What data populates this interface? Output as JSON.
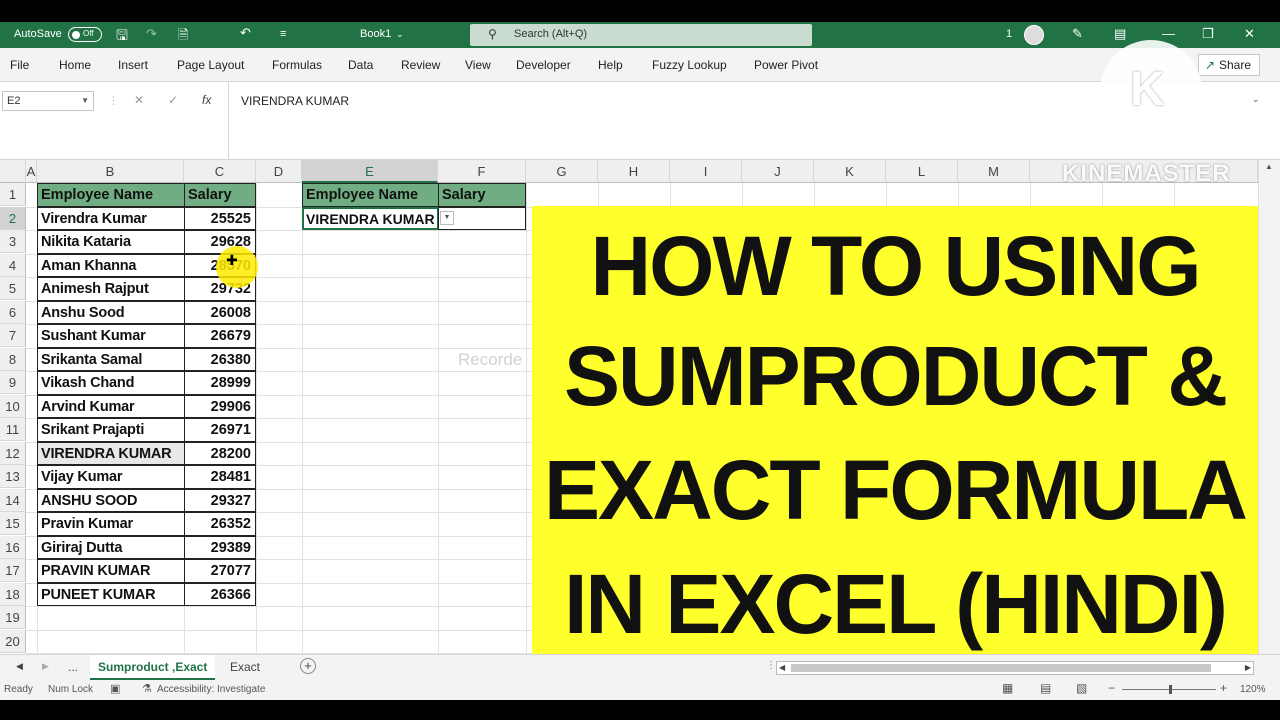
{
  "titlebar": {
    "autosave_label": "AutoSave",
    "autosave_state": "Off",
    "document_title": "Book1",
    "search_placeholder": "Search (Alt+Q)",
    "notification_count": "1"
  },
  "menu": {
    "items": [
      "File",
      "Home",
      "Insert",
      "Page Layout",
      "Formulas",
      "Data",
      "Review",
      "View",
      "Developer",
      "Help",
      "Fuzzy Lookup",
      "Power Pivot"
    ],
    "share_label": "Share"
  },
  "formula_bar": {
    "name_box": "E2",
    "fx_label": "fx",
    "value": "VIRENDRA KUMAR"
  },
  "columns": [
    "A",
    "B",
    "C",
    "D",
    "E",
    "F",
    "G",
    "H",
    "I",
    "J",
    "K",
    "L",
    "M"
  ],
  "rows": [
    "1",
    "2",
    "3",
    "4",
    "5",
    "6",
    "7",
    "8",
    "9",
    "10",
    "11",
    "12",
    "13",
    "14",
    "15",
    "16",
    "17",
    "18",
    "19",
    "20"
  ],
  "table": {
    "header_name": "Employee Name",
    "header_salary": "Salary",
    "records": [
      {
        "name": "Virendra Kumar",
        "salary": "25525"
      },
      {
        "name": "Nikita Kataria",
        "salary": "29628"
      },
      {
        "name": "Aman Khanna",
        "salary": "28570"
      },
      {
        "name": "Animesh Rajput",
        "salary": "29732"
      },
      {
        "name": "Anshu Sood",
        "salary": "26008"
      },
      {
        "name": "Sushant Kumar",
        "salary": "26679"
      },
      {
        "name": "Srikanta Samal",
        "salary": "26380"
      },
      {
        "name": "Vikash Chand",
        "salary": "28999"
      },
      {
        "name": "Arvind Kumar",
        "salary": "29906"
      },
      {
        "name": "Srikant Prajapti",
        "salary": "26971"
      },
      {
        "name": "VIRENDRA KUMAR",
        "salary": "28200"
      },
      {
        "name": "Vijay Kumar",
        "salary": "28481"
      },
      {
        "name": "ANSHU SOOD",
        "salary": "29327"
      },
      {
        "name": "Pravin Kumar",
        "salary": "26352"
      },
      {
        "name": "Giriraj Dutta",
        "salary": "29389"
      },
      {
        "name": "PRAVIN KUMAR",
        "salary": "27077"
      },
      {
        "name": "PUNEET KUMAR",
        "salary": "26366"
      }
    ]
  },
  "lookup": {
    "header_name": "Employee Name",
    "header_salary": "Salary",
    "selected_name": "VIRENDRA KUMAR"
  },
  "banner": {
    "lines": [
      "HOW TO USING",
      "SUMPRODUCT &",
      "EXACT FORMULA",
      "IN EXCEL (HINDI)"
    ],
    "background": "#ffff2b"
  },
  "watermark": {
    "logo_letter": "K",
    "brand": "KINEMASTER",
    "recorder_text": "Recorde"
  },
  "sheet_tabs": {
    "more": "...",
    "tabs": [
      "Sumproduct ,Exact",
      "Exact"
    ]
  },
  "status": {
    "ready": "Ready",
    "num_lock": "Num Lock",
    "accessibility": "Accessibility: Investigate",
    "zoom": "120%"
  },
  "colors": {
    "excel_green": "#217346",
    "header_fill": "#70ad82"
  }
}
